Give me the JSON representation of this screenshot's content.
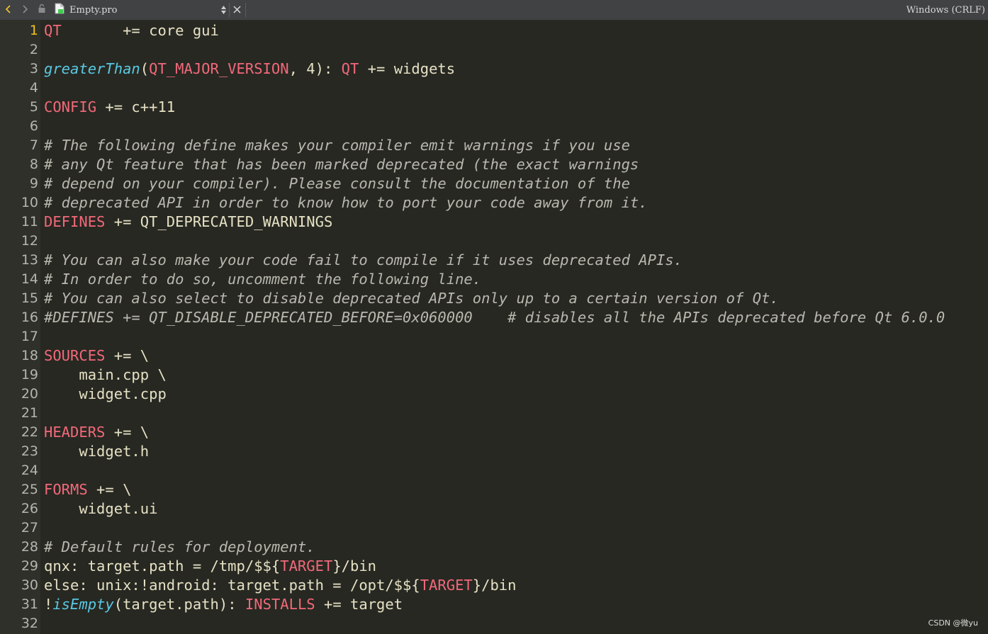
{
  "toolbar": {
    "file_name": "Empty.pro",
    "line_endings": "Windows (CRLF)"
  },
  "editor": {
    "current_line": 1,
    "lines": [
      {
        "num": "1",
        "tokens": [
          {
            "t": "QT",
            "s": "var"
          },
          {
            "t": "       += core gui",
            "s": "tx"
          }
        ]
      },
      {
        "num": "2",
        "tokens": []
      },
      {
        "num": "3",
        "tokens": [
          {
            "t": "greaterThan",
            "s": "fn"
          },
          {
            "t": "(",
            "s": "tx"
          },
          {
            "t": "QT_MAJOR_VERSION",
            "s": "var"
          },
          {
            "t": ", 4): ",
            "s": "tx"
          },
          {
            "t": "QT",
            "s": "var"
          },
          {
            "t": " += widgets",
            "s": "tx"
          }
        ]
      },
      {
        "num": "4",
        "tokens": []
      },
      {
        "num": "5",
        "tokens": [
          {
            "t": "CONFIG",
            "s": "var"
          },
          {
            "t": " += c++11",
            "s": "tx"
          }
        ]
      },
      {
        "num": "6",
        "tokens": []
      },
      {
        "num": "7",
        "tokens": [
          {
            "t": "# The following define makes your compiler emit warnings if you use",
            "s": "cm"
          }
        ]
      },
      {
        "num": "8",
        "tokens": [
          {
            "t": "# any Qt feature that has been marked deprecated (the exact warnings",
            "s": "cm"
          }
        ]
      },
      {
        "num": "9",
        "tokens": [
          {
            "t": "# depend on your compiler). Please consult the documentation of the",
            "s": "cm"
          }
        ]
      },
      {
        "num": "10",
        "tokens": [
          {
            "t": "# deprecated API in order to know how to port your code away from it.",
            "s": "cm"
          }
        ]
      },
      {
        "num": "11",
        "tokens": [
          {
            "t": "DEFINES",
            "s": "var"
          },
          {
            "t": " += QT_DEPRECATED_WARNINGS",
            "s": "tx"
          }
        ]
      },
      {
        "num": "12",
        "tokens": []
      },
      {
        "num": "13",
        "tokens": [
          {
            "t": "# You can also make your code fail to compile if it uses deprecated APIs.",
            "s": "cm"
          }
        ]
      },
      {
        "num": "14",
        "tokens": [
          {
            "t": "# In order to do so, uncomment the following line.",
            "s": "cm"
          }
        ]
      },
      {
        "num": "15",
        "tokens": [
          {
            "t": "# You can also select to disable deprecated APIs only up to a certain version of Qt.",
            "s": "cm"
          }
        ]
      },
      {
        "num": "16",
        "tokens": [
          {
            "t": "#DEFINES += QT_DISABLE_DEPRECATED_BEFORE=0x060000    # disables all the APIs deprecated before Qt 6.0.0",
            "s": "cm"
          }
        ]
      },
      {
        "num": "17",
        "tokens": []
      },
      {
        "num": "18",
        "tokens": [
          {
            "t": "SOURCES",
            "s": "var"
          },
          {
            "t": " += \\",
            "s": "tx"
          }
        ]
      },
      {
        "num": "19",
        "tokens": [
          {
            "t": "    main.cpp \\",
            "s": "tx"
          }
        ]
      },
      {
        "num": "20",
        "tokens": [
          {
            "t": "    widget.cpp",
            "s": "tx"
          }
        ]
      },
      {
        "num": "21",
        "tokens": []
      },
      {
        "num": "22",
        "tokens": [
          {
            "t": "HEADERS",
            "s": "var"
          },
          {
            "t": " += \\",
            "s": "tx"
          }
        ]
      },
      {
        "num": "23",
        "tokens": [
          {
            "t": "    widget.h",
            "s": "tx"
          }
        ]
      },
      {
        "num": "24",
        "tokens": []
      },
      {
        "num": "25",
        "tokens": [
          {
            "t": "FORMS",
            "s": "var"
          },
          {
            "t": " += \\",
            "s": "tx"
          }
        ]
      },
      {
        "num": "26",
        "tokens": [
          {
            "t": "    widget.ui",
            "s": "tx"
          }
        ]
      },
      {
        "num": "27",
        "tokens": []
      },
      {
        "num": "28",
        "tokens": [
          {
            "t": "# Default rules for deployment.",
            "s": "cm"
          }
        ]
      },
      {
        "num": "29",
        "tokens": [
          {
            "t": "qnx: target.path = /tmp/$${",
            "s": "tx"
          },
          {
            "t": "TARGET",
            "s": "var"
          },
          {
            "t": "}/bin",
            "s": "tx"
          }
        ]
      },
      {
        "num": "30",
        "tokens": [
          {
            "t": "else: unix:!android: target.path = /opt/$${",
            "s": "tx"
          },
          {
            "t": "TARGET",
            "s": "var"
          },
          {
            "t": "}/bin",
            "s": "tx"
          }
        ]
      },
      {
        "num": "31",
        "tokens": [
          {
            "t": "!",
            "s": "tx"
          },
          {
            "t": "isEmpty",
            "s": "fn"
          },
          {
            "t": "(target.path): ",
            "s": "tx"
          },
          {
            "t": "INSTALLS",
            "s": "var"
          },
          {
            "t": " += target",
            "s": "tx"
          }
        ]
      },
      {
        "num": "32",
        "tokens": []
      }
    ]
  },
  "watermark": "CSDN @微yu",
  "colors": {
    "background": "#272822",
    "gutter": "#2f302a",
    "variable": "#f2697a",
    "function": "#59c9e3",
    "comment": "#b9b8ae",
    "text": "#e6e1c4",
    "current_line_number": "#f0c51e"
  },
  "icons": {
    "back": "chevron-left-icon",
    "forward": "chevron-right-icon",
    "lock": "lock-icon",
    "file": "qt-project-file-icon",
    "selector": "up-down-arrows-icon",
    "close": "close-icon"
  }
}
